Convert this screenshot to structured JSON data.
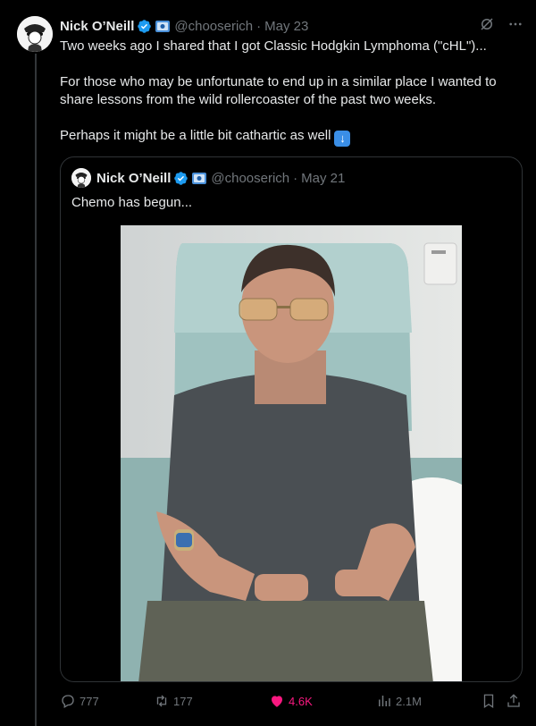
{
  "tweet": {
    "author_name": "Nick O’Neill",
    "handle": "@chooserich",
    "separator": "·",
    "date": "May 23",
    "paragraphs": [
      "Two weeks ago I shared that I got Classic Hodgkin Lymphoma (\"cHL\")...",
      "For those who may be unfortunate to end up in a similar place I wanted to share lessons from the wild rollercoaster of the past two weeks.",
      "Perhaps it might be a little bit cathartic as well"
    ],
    "emoji": "down-arrow-emoji"
  },
  "quote": {
    "author_name": "Nick O’Neill",
    "handle": "@chooserich",
    "separator": "·",
    "date": "May 21",
    "text": "Chemo has begun..."
  },
  "actions": {
    "replies": "777",
    "retweets": "177",
    "likes": "4.6K",
    "views": "2.1M"
  },
  "colors": {
    "background": "#000000",
    "text": "#e7e9ea",
    "muted": "#71767b",
    "verified": "#1d9bf0",
    "like": "#f91880",
    "border": "#2f3336"
  },
  "icons": [
    "verified-badge-icon",
    "flag-badge-icon",
    "grok-icon",
    "more-icon",
    "reply-icon",
    "retweet-icon",
    "heart-icon",
    "views-icon",
    "bookmark-icon",
    "share-icon"
  ]
}
